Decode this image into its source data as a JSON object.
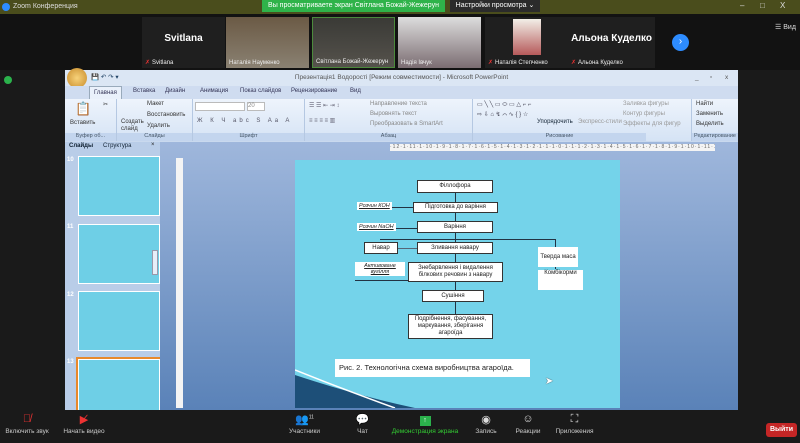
{
  "zoom": {
    "title": "Zoom Конференция",
    "banner": "Вы просматриваете экран Світлана Божай-Жежерун",
    "view_settings": "Настройки просмотра",
    "view_label": "Вид",
    "participants": [
      {
        "big": "Svitlana",
        "name": "Svitlana",
        "muted": true
      },
      {
        "big": "",
        "name": "Наталія Науменко",
        "muted": false
      },
      {
        "big": "",
        "name": "Світлана Божай-Жежерун",
        "muted": false
      },
      {
        "big": "",
        "name": "Надія Івчук",
        "muted": false
      },
      {
        "big": "",
        "name": "Наталія Степченко",
        "muted": true
      },
      {
        "big": "Альона Куделко",
        "name": "Альона Куделко",
        "muted": true
      }
    ],
    "toolbar": {
      "audio": "Включить звук",
      "video": "Начать видео",
      "participants": "Участники",
      "participants_count": "11",
      "chat": "Чат",
      "share": "Демонстрация экрана",
      "record": "Запись",
      "reactions": "Реакции",
      "apps": "Приложения",
      "leave": "Выйти"
    }
  },
  "ppt": {
    "title": "Презентація1 Водорості [Режим совместимости] - Microsoft PowerPoint",
    "tabs": [
      "Главная",
      "Вставка",
      "Дизайн",
      "Анимация",
      "Показ слайдов",
      "Рецензирование",
      "Вид"
    ],
    "ribbon": {
      "paste": "Вставить",
      "clipboard": "Буфер об...",
      "create_slide": "Создать слайд",
      "layout": "Макет",
      "restore": "Восстановить",
      "delete": "Удалить",
      "slides": "Слайды",
      "font_size": "20",
      "font": "Шрифт",
      "paragraph": "Абзац",
      "text_dir": "Направление текста",
      "align_text": "Выровнять текст",
      "smartart": "Преобразовать в SmartArt",
      "arrange": "Упорядочить",
      "quick_styles": "Экспресс-стили",
      "fill": "Заливка фигуры",
      "outline": "Контур фигуры",
      "effects": "Эффекты для фигур",
      "drawing": "Рисование",
      "find": "Найти",
      "replace": "Заменить",
      "select": "Выделить",
      "editing": "Редактирование"
    },
    "pane_tabs": [
      "Слайды",
      "Структура"
    ],
    "thumbs": [
      "10",
      "11",
      "12",
      "13"
    ],
    "ruler": "·12·1·11·1·10·1·9·1·8·1·7·1·6·1·5·1·4·1·3·1·2·1·1·1·0·1·1·1·2·1·3·1·4·1·5·1·6·1·7·1·8·1·9·1·10·1·11·1·12·"
  },
  "slide": {
    "boxes": {
      "fillofora": "Філлофора",
      "prep": "Підготовка до варіння",
      "boil": "Варіння",
      "navar": "Навар",
      "drain": "Зливання навару",
      "solid": "Тверда маса",
      "feed": "Комбікорми",
      "bleach": "Знебарвлення і видалення білкових речовин з навару",
      "dry": "Сушіння",
      "grind": "Подрібнення, фасування, маркування, зберігання агароїда"
    },
    "labels": {
      "koh": "Розчин КОН",
      "naoh": "Розчин NaOH",
      "carbon": "Активоване вугілля"
    },
    "caption": "Рис. 2. Технологічна схема виробництва агароїда."
  }
}
